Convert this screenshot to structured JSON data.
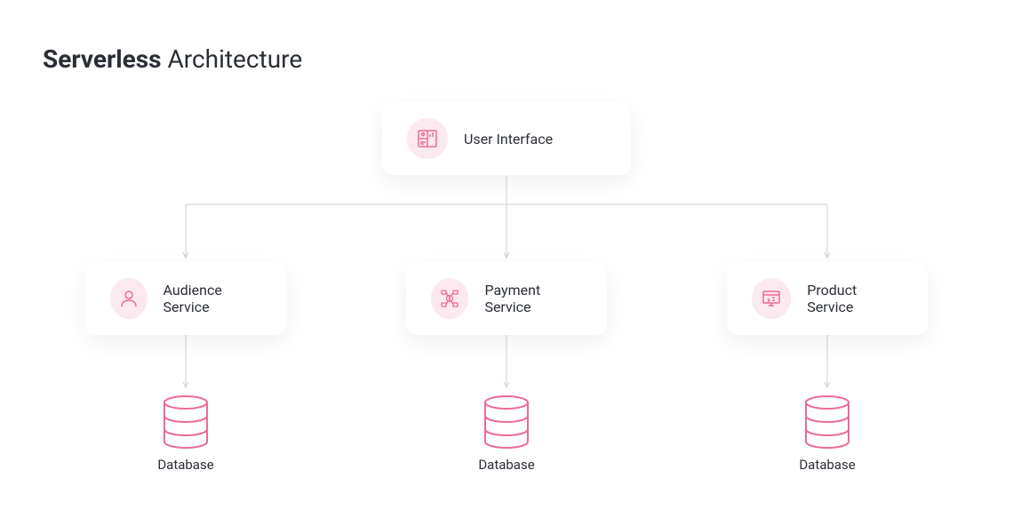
{
  "title": {
    "bold": "Serverless",
    "light": "Architecture"
  },
  "nodes": {
    "top": {
      "label": "User Interface",
      "icon": "dashboard-icon"
    },
    "left": {
      "label": "Audience Service",
      "icon": "user-icon"
    },
    "middle": {
      "label": "Payment Service",
      "icon": "payment-icon"
    },
    "right": {
      "label": "Product Service",
      "icon": "product-icon"
    }
  },
  "databases": {
    "left": {
      "label": "Database"
    },
    "middle": {
      "label": "Database"
    },
    "right": {
      "label": "Database"
    }
  },
  "colors": {
    "accent": "#ec6a9a",
    "accent_light": "#fce8ef",
    "text": "#2a2e35",
    "line": "#cfcfcf"
  }
}
